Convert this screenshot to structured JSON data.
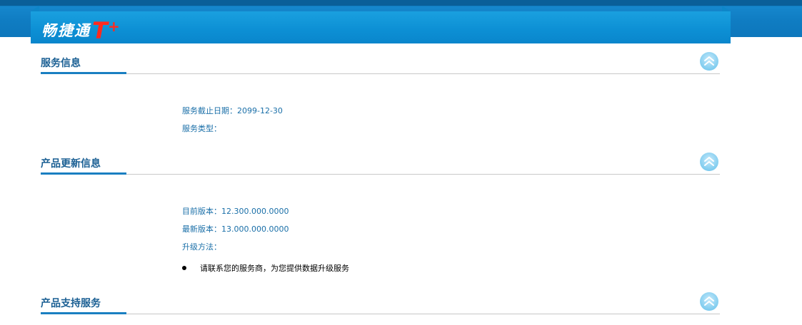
{
  "header": {
    "logo_text": "畅捷通",
    "logo_t": "T",
    "logo_plus": "+"
  },
  "sections": {
    "service": {
      "title": "服务信息",
      "expiry": "服务截止日期：2099-12-30",
      "type": "服务类型："
    },
    "update": {
      "title": "产品更新信息",
      "current_version": "目前版本：12.300.000.0000",
      "latest_version": "最新版本：13.000.000.0000",
      "upgrade_method": "升级方法：",
      "upgrade_item": "请联系您的服务商，为您提供数据升级服务"
    },
    "support": {
      "title": "产品支持服务"
    }
  },
  "icons": {
    "collapse": "double-chevron-up-icon"
  },
  "colors": {
    "banner": "#0c8fd4",
    "title": "#1a5f93",
    "info_text": "#1a6fa8",
    "accent_rule": "#1a7fc1",
    "logo_red": "#ff2a1f"
  }
}
